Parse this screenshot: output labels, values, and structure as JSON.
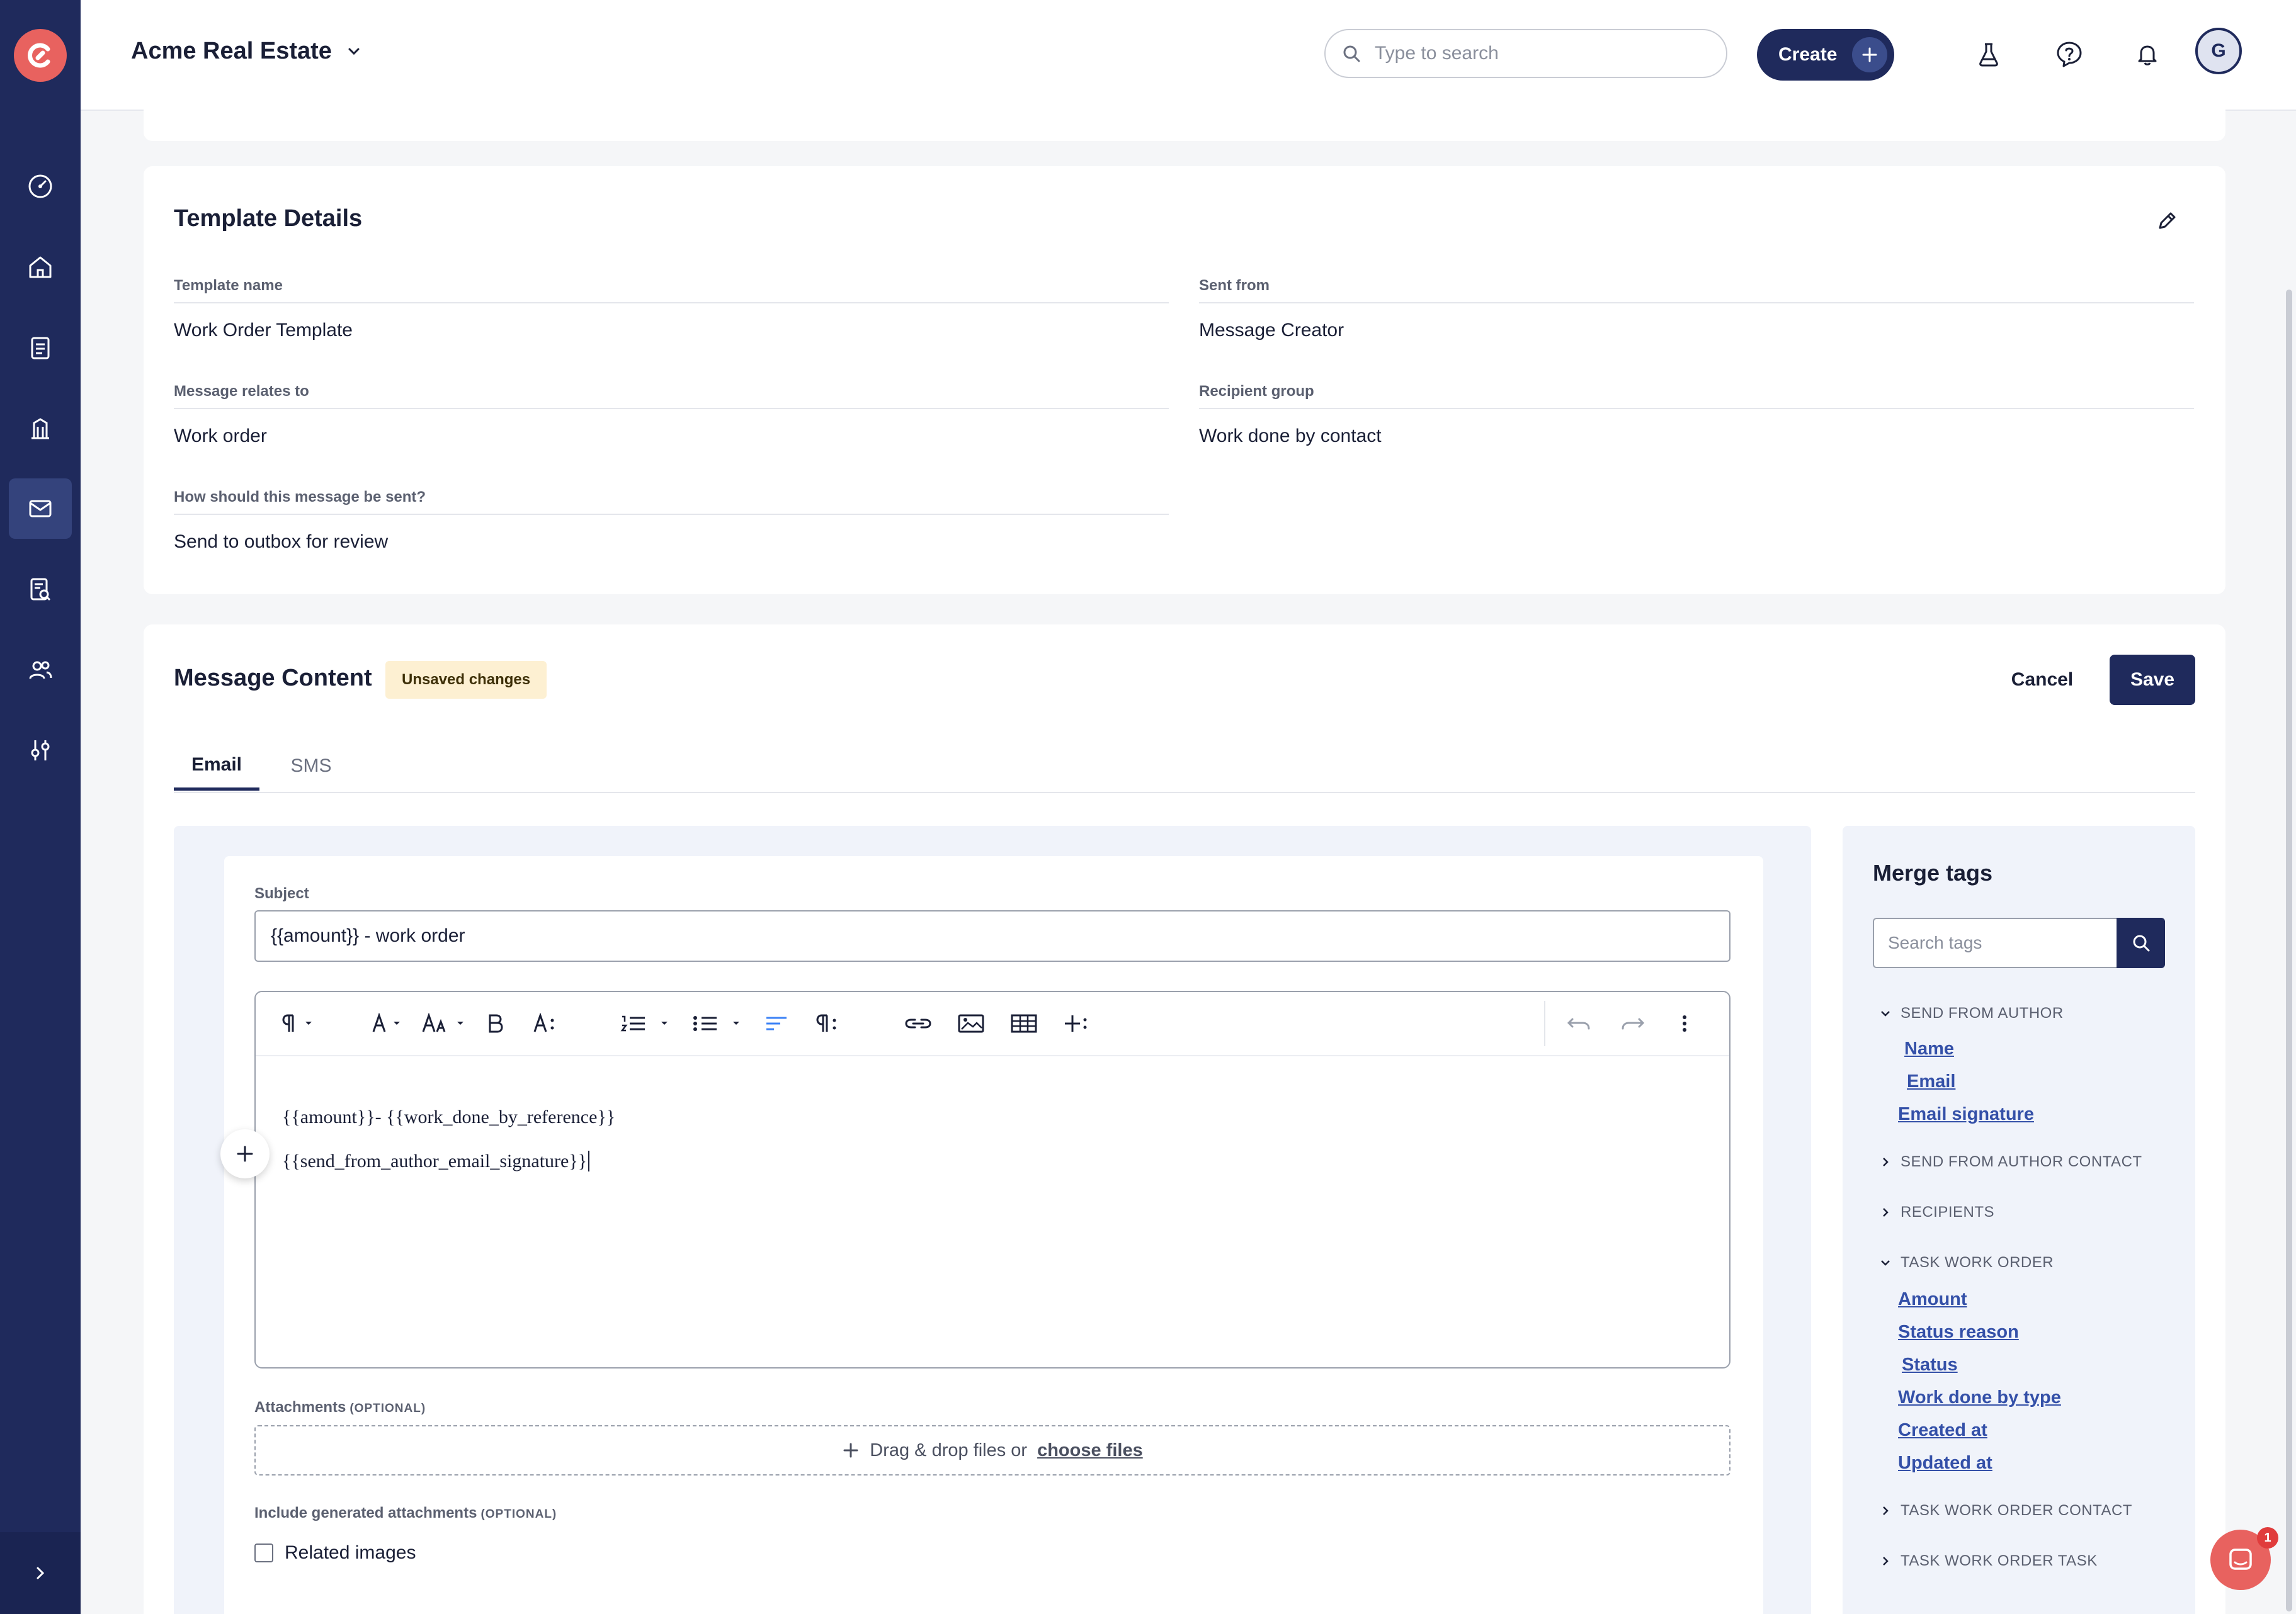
{
  "topbar": {
    "org_name": "Acme Real Estate",
    "search_placeholder": "Type to search",
    "create_label": "Create",
    "avatar_initial": "G"
  },
  "sidebar": {
    "items": [
      {
        "name": "dashboard",
        "icon": "gauge-icon"
      },
      {
        "name": "properties",
        "icon": "home-icon"
      },
      {
        "name": "tasks",
        "icon": "clipboard-icon"
      },
      {
        "name": "buildings",
        "icon": "building-icon"
      },
      {
        "name": "messages",
        "icon": "mail-icon",
        "active": true
      },
      {
        "name": "reports",
        "icon": "report-search-icon"
      },
      {
        "name": "contacts",
        "icon": "users-icon"
      },
      {
        "name": "settings",
        "icon": "sliders-icon"
      }
    ]
  },
  "template_details": {
    "title": "Template Details",
    "fields": {
      "template_name": {
        "label": "Template name",
        "value": "Work Order Template"
      },
      "sent_from": {
        "label": "Sent from",
        "value": "Message Creator"
      },
      "relates_to": {
        "label": "Message relates to",
        "value": "Work order"
      },
      "recipient_group": {
        "label": "Recipient group",
        "value": "Work done by contact"
      },
      "send_method": {
        "label": "How should this message be sent?",
        "value": "Send to outbox for review"
      }
    }
  },
  "message_content": {
    "title": "Message Content",
    "badge": "Unsaved changes",
    "cancel_label": "Cancel",
    "save_label": "Save",
    "tabs": [
      "Email",
      "SMS"
    ],
    "active_tab": "Email",
    "subject_label": "Subject",
    "subject_value": "{{amount}} - work order",
    "body_lines": [
      "{{amount}}- {{work_done_by_reference}}",
      "{{send_from_author_email_signature}}"
    ],
    "attachments_label": "Attachments",
    "attachments_optional": "(OPTIONAL)",
    "dropzone_text": "Drag & drop files or",
    "dropzone_link": "choose files",
    "generated_label": "Include generated attachments",
    "generated_optional": "(OPTIONAL)",
    "related_images_label": "Related images"
  },
  "merge_tags": {
    "title": "Merge tags",
    "search_placeholder": "Search tags",
    "groups": {
      "send_from_author": {
        "label": "SEND FROM AUTHOR",
        "expanded": true,
        "tags": [
          "Name",
          "Email",
          "Email signature"
        ]
      },
      "send_from_author_contact": {
        "label": "SEND FROM AUTHOR CONTACT",
        "expanded": false
      },
      "recipients": {
        "label": "RECIPIENTS",
        "expanded": false
      },
      "task_work_order": {
        "label": "TASK WORK ORDER",
        "expanded": true,
        "tags": [
          "Amount",
          "Status reason",
          "Status",
          "Work done by type",
          "Created at",
          "Updated at"
        ]
      },
      "task_work_order_contact": {
        "label": "TASK WORK ORDER CONTACT",
        "expanded": false
      },
      "task_work_order_task": {
        "label": "TASK WORK ORDER TASK",
        "expanded": false
      }
    }
  },
  "chat": {
    "badge_count": "1"
  },
  "colors": {
    "sidebar": "#1f2a5c",
    "brand_accent": "#e8625f",
    "primary": "#1f2a5c",
    "link": "#3450a8",
    "badge_bg": "#fdf0d2"
  }
}
